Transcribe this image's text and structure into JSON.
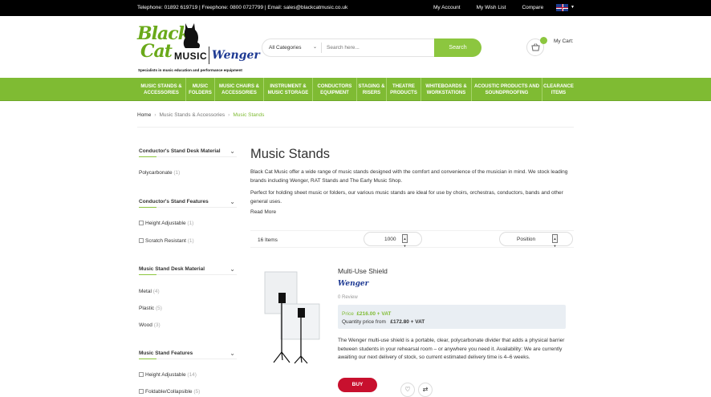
{
  "topbar": {
    "contact": "Telephone: 01892 619719 | Freephone: 0800 0727799 | Email: sales@blackcatmusic.co.uk",
    "links": [
      "My Account",
      "My Wish List",
      "Compare"
    ],
    "language_icon": "uk-flag-icon"
  },
  "header": {
    "logo_line1": "Black",
    "logo_line2": "Cat",
    "logo_music": "MUSIC",
    "logo_partner": "Wenger",
    "logo_tagline": "Specialists in music education and performance equipment",
    "search": {
      "category": "All Categories",
      "placeholder": "Search here...",
      "button": "Search"
    },
    "cart_label": "My Cart:"
  },
  "nav": [
    {
      "line1": "MUSIC STANDS &",
      "line2": "ACCESSORIES"
    },
    {
      "line1": "MUSIC",
      "line2": "FOLDERS"
    },
    {
      "line1": "MUSIC CHAIRS &",
      "line2": "ACCESSORIES"
    },
    {
      "line1": "INSTRUMENT &",
      "line2": "MUSIC STORAGE"
    },
    {
      "line1": "CONDUCTORS",
      "line2": "EQUIPMENT"
    },
    {
      "line1": "STAGING &",
      "line2": "RISERS"
    },
    {
      "line1": "THEATRE",
      "line2": "PRODUCTS"
    },
    {
      "line1": "WHITEBOARDS &",
      "line2": "WORKSTATIONS"
    },
    {
      "line1": "ACOUSTIC PRODUCTS AND",
      "line2": "SOUNDPROOFING"
    },
    {
      "line1": "CLEARANCE",
      "line2": "ITEMS"
    }
  ],
  "breadcrumb": {
    "home": "Home",
    "parent": "Music Stands & Accessories",
    "current": "Music Stands"
  },
  "filters": [
    {
      "title": "Conductor's Stand Desk Material",
      "options": [
        {
          "label": "Polycarbonate",
          "count": "(1)",
          "checkbox": false
        }
      ]
    },
    {
      "title": "Conductor's Stand Features",
      "options": [
        {
          "label": "Height Adjustable",
          "count": "(1)",
          "checkbox": true
        },
        {
          "label": "Scratch Resistant",
          "count": "(1)",
          "checkbox": true
        }
      ]
    },
    {
      "title": "Music Stand Desk Material",
      "options": [
        {
          "label": "Metal",
          "count": "(4)",
          "checkbox": false
        },
        {
          "label": "Plastic",
          "count": "(5)",
          "checkbox": false
        },
        {
          "label": "Wood",
          "count": "(3)",
          "checkbox": false
        }
      ]
    },
    {
      "title": "Music Stand Features",
      "options": [
        {
          "label": "Height Adjustable",
          "count": "(14)",
          "checkbox": true
        },
        {
          "label": "Foldable/Collapsible",
          "count": "(5)",
          "checkbox": true
        }
      ]
    }
  ],
  "category": {
    "title": "Music Stands",
    "description_1": "Black Cat Music offer a wide range of music stands designed with the comfort and convenience of the musician in mind. We stock leading brands including Wenger, RAT Stands and The Early Music Shop.",
    "description_2": "Perfect for holding sheet music or folders, our various music stands are ideal for use by choirs, orchestras, conductors, bands and other general uses.",
    "read_more": "Read More"
  },
  "toolbar": {
    "items_count": "16 Items",
    "limiter": "1000",
    "sort_by": "Position"
  },
  "product": {
    "name": "Multi-Use Shield",
    "brand": "Wenger",
    "reviews": "0 Review",
    "price_label": "Price",
    "price": "£216.00 + VAT",
    "qty_label": "Quantity price from",
    "qty_price": "£172.80 + VAT",
    "description": "The Wenger multi-use shield is a portable, clear, polycarbonate divider that adds a physical barrier between students in your rehearsal room – or anywhere you need it. Availability: We are currently awaiting our next delivery of stock, so current estimated delivery time is 4–6 weeks.",
    "buy_label": "BUY"
  },
  "colors": {
    "brand_green": "#7fbb33",
    "buy_red": "#c8102e",
    "wenger_blue": "#1e3a93"
  }
}
